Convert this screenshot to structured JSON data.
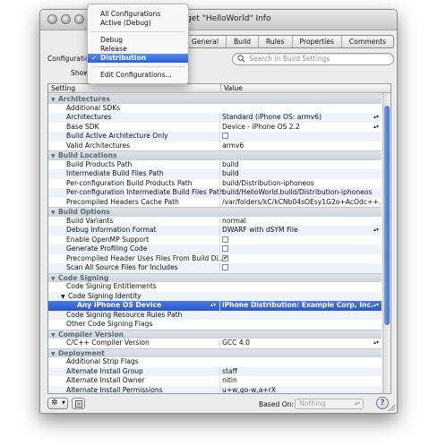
{
  "window": {
    "title": "Target \"HelloWorld\" Info"
  },
  "toolbar": {
    "tabs": [
      "General",
      "Build",
      "Rules",
      "Properties",
      "Comments"
    ]
  },
  "configuration": {
    "label": "Configuration:",
    "show_label": "Show:"
  },
  "config_menu": {
    "items": [
      "All Configurations",
      "Active (Debug)",
      "Debug",
      "Release",
      "Distribution",
      "Edit Configurations..."
    ],
    "selected": "Distribution",
    "check_glyph": "✓"
  },
  "search": {
    "placeholder": "Search in Build Settings",
    "icon": "magnifier-icon"
  },
  "table": {
    "headers": [
      "Setting",
      "Value"
    ],
    "rows": [
      {
        "type": "group",
        "name": "Architectures"
      },
      {
        "name": "Additional SDKs",
        "value": ""
      },
      {
        "name": "Architectures",
        "value": "Standard (iPhone OS: armv6)",
        "popup": true
      },
      {
        "name": "Base SDK",
        "value": "Device - iPhone OS 2.2",
        "popup": true
      },
      {
        "name": "Build Active Architecture Only",
        "checkbox": false
      },
      {
        "name": "Valid Architectures",
        "value": "armv6"
      },
      {
        "type": "group",
        "name": "Build Locations"
      },
      {
        "name": "Build Products Path",
        "value": "build"
      },
      {
        "name": "Intermediate Build Files Path",
        "value": "build"
      },
      {
        "name": "Per-configuration Build Products Path",
        "value": "build/Distribution-iphoneos"
      },
      {
        "name": "Per-configuration Intermediate Build Files Path",
        "value": "build/HelloWorld.build/Distribution-iphoneos"
      },
      {
        "name": "Precompiled Headers Cache Path",
        "value": "/var/folders/kC/kCNb04sOEsy1G2o+AcOdc++..."
      },
      {
        "type": "group",
        "name": "Build Options"
      },
      {
        "name": "Build Variants",
        "value": "normal"
      },
      {
        "name": "Debug Information Format",
        "value": "DWARF with dSYM File",
        "popup": true
      },
      {
        "name": "Enable OpenMP Support",
        "checkbox": false
      },
      {
        "name": "Generate Profiling Code",
        "checkbox": false
      },
      {
        "name": "Precompiled Header Uses Files From Build Di...",
        "checkbox": true
      },
      {
        "name": "Scan All Source Files for Includes",
        "checkbox": false
      },
      {
        "type": "group",
        "name": "Code Signing"
      },
      {
        "name": "Code Signing Entitlements",
        "value": ""
      },
      {
        "name": "Code Signing Identity",
        "value": "",
        "expanded": true
      },
      {
        "name": "Any iPhone OS Device",
        "value": "iPhone Distribution: Example Corp, Inc.",
        "popup": true,
        "selected": true,
        "indent": 2
      },
      {
        "name": "Code Signing Resource Rules Path",
        "value": ""
      },
      {
        "name": "Other Code Signing Flags",
        "value": ""
      },
      {
        "type": "group",
        "name": "Compiler Version"
      },
      {
        "name": "C/C++ Compiler Version",
        "value": "GCC 4.0",
        "popup": true
      },
      {
        "type": "group",
        "name": "Deployment"
      },
      {
        "name": "Additional Strip Flags",
        "value": ""
      },
      {
        "name": "Alternate Install Group",
        "value": "staff"
      },
      {
        "name": "Alternate Install Owner",
        "value": "nitin"
      },
      {
        "name": "Alternate Install Permissions",
        "value": "u+w,go-w,a+rX"
      }
    ]
  },
  "bottom": {
    "based_on_label": "Based On:",
    "based_on_value": "Nothing",
    "help": "?"
  },
  "colors": {
    "selection": "#2d5fd9",
    "group_text": "#5d6975"
  }
}
